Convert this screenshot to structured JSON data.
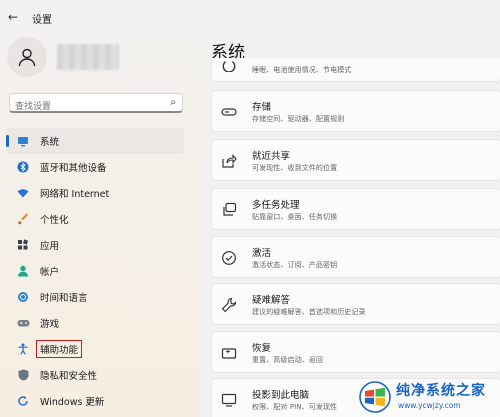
{
  "app": {
    "title": "设置"
  },
  "search": {
    "placeholder": "查找设置"
  },
  "sidebar": {
    "items": [
      {
        "label": "系统",
        "icon": "monitor-icon",
        "active": true
      },
      {
        "label": "蓝牙和其他设备",
        "icon": "bluetooth-icon"
      },
      {
        "label": "网络和 Internet",
        "icon": "wifi-icon"
      },
      {
        "label": "个性化",
        "icon": "brush-icon"
      },
      {
        "label": "应用",
        "icon": "apps-icon"
      },
      {
        "label": "帐户",
        "icon": "person-icon"
      },
      {
        "label": "时间和语言",
        "icon": "globe-clock-icon"
      },
      {
        "label": "游戏",
        "icon": "gamepad-icon"
      },
      {
        "label": "辅助功能",
        "icon": "accessibility-icon",
        "highlighted": true
      },
      {
        "label": "隐私和安全性",
        "icon": "shield-icon"
      },
      {
        "label": "Windows 更新",
        "icon": "update-icon"
      }
    ]
  },
  "main": {
    "title": "系统",
    "partial_card_sub": "睡眠、电池使用情况、节电模式",
    "cards": [
      {
        "title": "存储",
        "sub": "存储空间、驱动器、配置规则",
        "icon": "storage-icon"
      },
      {
        "title": "就近共享",
        "sub": "可发现性、收到文件的位置",
        "icon": "share-icon"
      },
      {
        "title": "多任务处理",
        "sub": "贴靠窗口、桌面、任务切换",
        "icon": "multitask-icon"
      },
      {
        "title": "激活",
        "sub": "激活状态、订阅、产品密钥",
        "icon": "check-circle-icon"
      },
      {
        "title": "疑难解答",
        "sub": "建议的疑难解答、首选项和历史记录",
        "icon": "wrench-icon"
      },
      {
        "title": "恢复",
        "sub": "重置、高级启动、返回",
        "icon": "recovery-icon"
      },
      {
        "title": "投影到此电脑",
        "sub": "权限、配对 PIN、可发现性",
        "icon": "project-icon"
      }
    ]
  },
  "watermark": {
    "name": "纯净系统之家",
    "url": "www.ycwjzy.com"
  },
  "colors": {
    "accent": "#1b68c6",
    "highlight_border": "#d11a1a"
  }
}
